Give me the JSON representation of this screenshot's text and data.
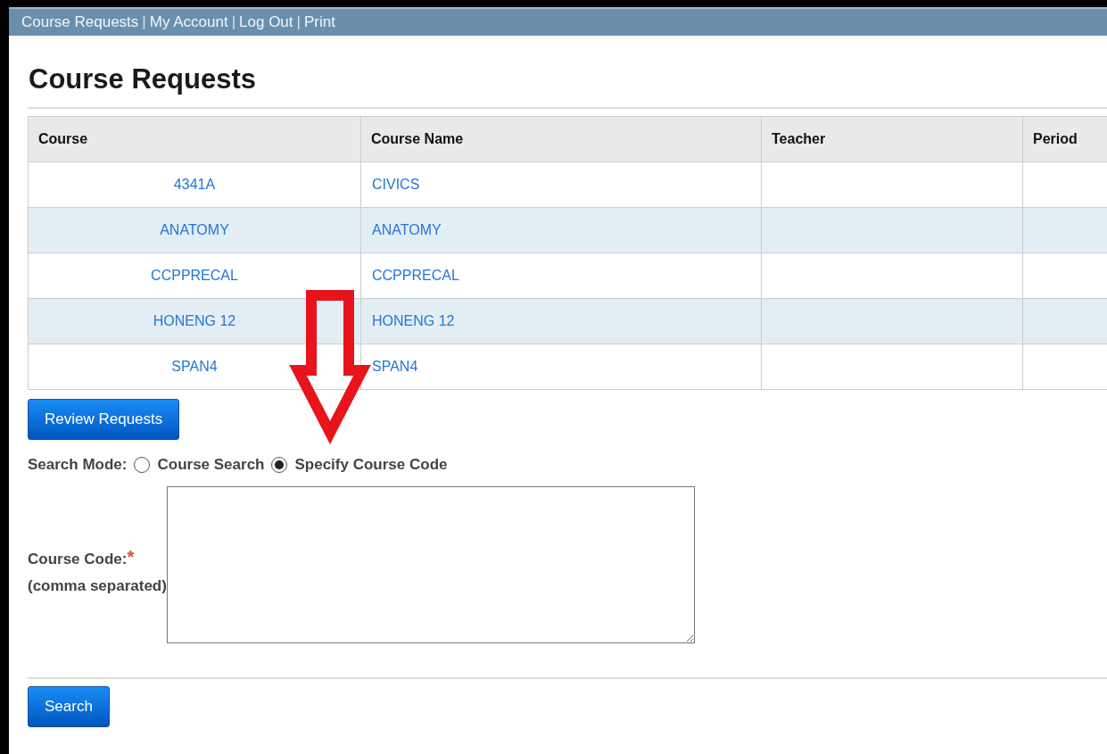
{
  "nav": [
    {
      "kind": "link",
      "label": "Course Requests"
    },
    {
      "kind": "separator",
      "label": "|"
    },
    {
      "kind": "link",
      "label": "My Account"
    },
    {
      "kind": "separator",
      "label": "|"
    },
    {
      "kind": "link",
      "label": "Log Out"
    },
    {
      "kind": "separator",
      "label": "|"
    },
    {
      "kind": "link",
      "label": "Print"
    }
  ],
  "title": "Course Requests",
  "table": {
    "columns": [
      "Course",
      "Course Name",
      "Teacher",
      "Period"
    ],
    "rows": [
      [
        "4341A",
        "CIVICS",
        "",
        ""
      ],
      [
        "ANATOMY",
        "ANATOMY",
        "",
        ""
      ],
      [
        "CCPPRECAL",
        "CCPPRECAL",
        "",
        ""
      ],
      [
        "HONENG 12",
        "HONENG 12",
        "",
        ""
      ],
      [
        "SPAN4",
        "SPAN4",
        "",
        ""
      ]
    ]
  },
  "review_button": "Review Requests",
  "search_mode": {
    "label": "Search Mode:",
    "options": [
      {
        "label": "Course Search",
        "selected": false
      },
      {
        "label": "Specify Course Code",
        "selected": true
      }
    ]
  },
  "course_code": {
    "label": "Course Code:",
    "required_mark": "*",
    "hint": "(comma separated)"
  },
  "search_button": "Search",
  "annotation": {
    "kind": "down-arrow"
  }
}
